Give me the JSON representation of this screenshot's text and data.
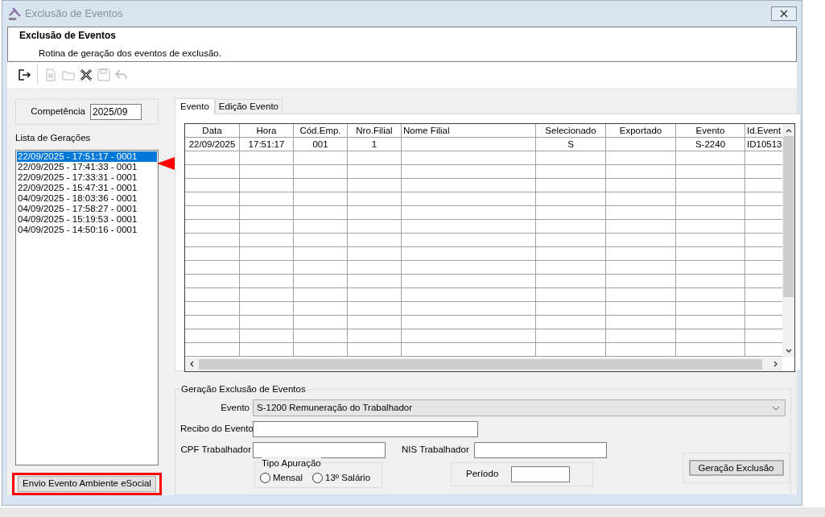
{
  "window": {
    "title": "Exclusão de Eventos"
  },
  "header": {
    "title": "Exclusão de Eventos",
    "subtitle": "Rotina de geração dos eventos de exclusão."
  },
  "toolbar": [
    {
      "kind": "exit",
      "disabled": false
    },
    {
      "kind": "new",
      "disabled": true
    },
    {
      "kind": "open",
      "disabled": true
    },
    {
      "kind": "delete",
      "disabled": false
    },
    {
      "kind": "save",
      "disabled": true
    },
    {
      "kind": "undo",
      "disabled": true
    }
  ],
  "competencia": {
    "label": "Competência",
    "value": "2025/09"
  },
  "generations": {
    "label": "Lista de Gerações",
    "items": [
      {
        "text": "22/09/2025 - 17:51:17 - 0001",
        "selected": true
      },
      {
        "text": "22/09/2025 - 17:41:33 - 0001",
        "selected": false
      },
      {
        "text": "22/09/2025 - 17:33:31 - 0001",
        "selected": false
      },
      {
        "text": "22/09/2025 - 15:47:31 - 0001",
        "selected": false
      },
      {
        "text": "04/09/2025 - 18:03:36 - 0001",
        "selected": false
      },
      {
        "text": "04/09/2025 - 17:58:27 - 0001",
        "selected": false
      },
      {
        "text": "04/09/2025 - 15:19:53 - 0001",
        "selected": false
      },
      {
        "text": "04/09/2025 - 14:50:16 - 0001",
        "selected": false
      }
    ]
  },
  "send_button": "Envio Evento Ambiente eSocial",
  "tabs": [
    {
      "label": "Evento",
      "selected": true
    },
    {
      "label": "Edição Evento",
      "selected": false
    }
  ],
  "table": {
    "columns": [
      "Data",
      "Hora",
      "Cód.Emp.",
      "Nro.Filial",
      "Nome Filial",
      "Selecionado",
      "Exportado",
      "Evento",
      "Id.Event"
    ],
    "rows": [
      [
        "22/09/2025",
        "17:51:17",
        "001",
        "1",
        "",
        "S",
        "",
        "S-2240",
        "ID10513"
      ]
    ]
  },
  "form": {
    "title": "Geração Exclusão de Eventos",
    "evento_label": "Evento",
    "evento_value": "S-1200 Remuneração do Trabalhador",
    "recibo_label": "Recibo do Evento",
    "cpf_label": "CPF Trabalhador",
    "nis_label": "NIS Trabalhador",
    "tipo_label": "Tipo Apuração",
    "options": [
      {
        "label": "Mensal",
        "selected": false
      },
      {
        "label": "13º Salário",
        "selected": false
      }
    ],
    "periodo_label": "Período",
    "button": "Geração  Exclusão"
  }
}
